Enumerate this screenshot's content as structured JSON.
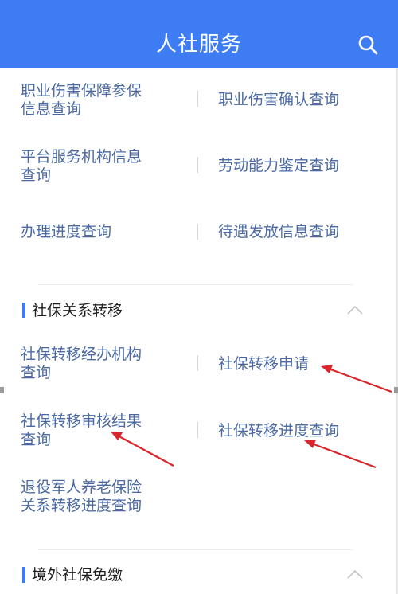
{
  "header": {
    "title": "人社服务",
    "search_icon": "search-icon"
  },
  "group1": {
    "rows": [
      {
        "left": "职业伤害保障参保\n信息查询",
        "right": "职业伤害确认查询"
      },
      {
        "left": "平台服务机构信息\n查询",
        "right": "劳动能力鉴定查询"
      },
      {
        "left": "办理进度查询",
        "right": "待遇发放信息查询"
      }
    ]
  },
  "section_transfer": {
    "title": "社保关系转移",
    "rows": [
      {
        "left": "社保转移经办机构\n查询",
        "right": "社保转移申请"
      },
      {
        "left": "社保转移审核结果\n查询",
        "right": "社保转移进度查询"
      },
      {
        "left": "退役军人养老保险\n关系转移进度查询",
        "right": ""
      }
    ]
  },
  "section_overseas": {
    "title": "境外社保免缴"
  },
  "colors": {
    "brand": "#3e7cf3",
    "link_text": "#4b6aa3",
    "annotation_arrow": "#d9262c"
  }
}
